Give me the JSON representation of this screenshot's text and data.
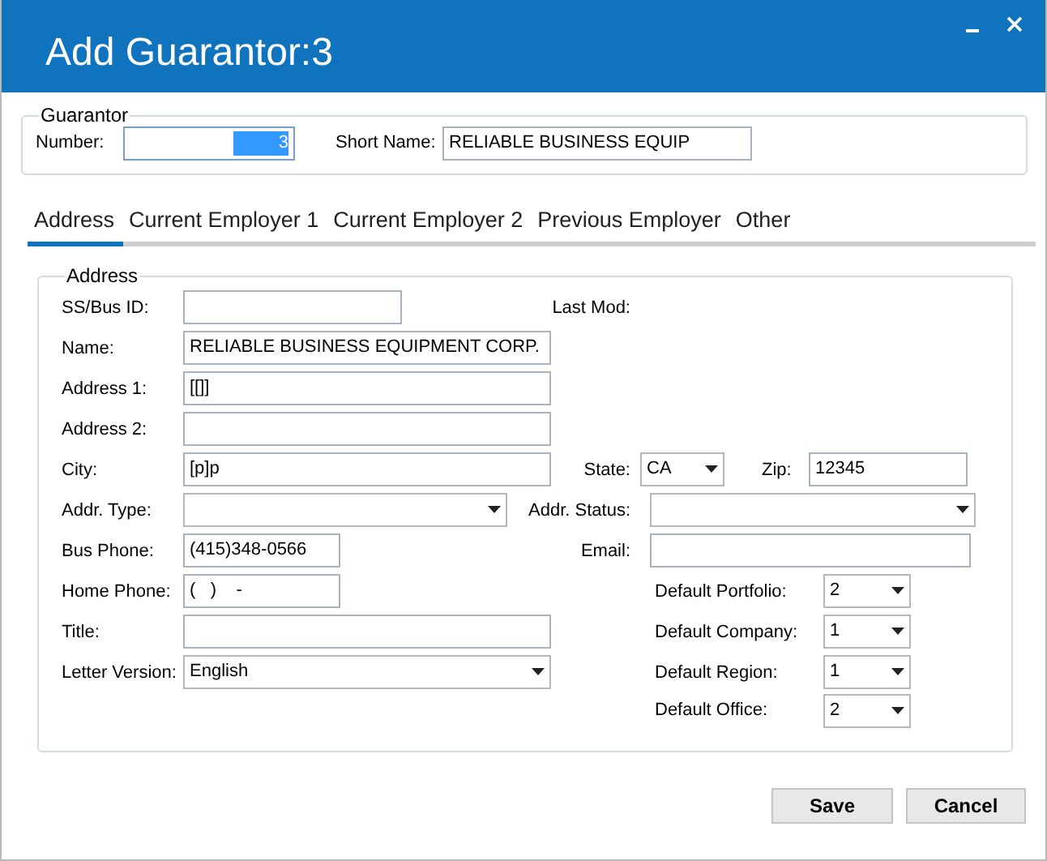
{
  "window": {
    "title": "Add Guarantor:3"
  },
  "guarantor": {
    "legend": "Guarantor",
    "number": {
      "label": "Number:",
      "value": "3",
      "text_selected": true
    },
    "short_name": {
      "label": "Short Name:",
      "value": "RELIABLE BUSINESS EQUIP"
    }
  },
  "tabs": [
    {
      "label": "Address",
      "selected": true
    },
    {
      "label": "Current Employer 1",
      "selected": false
    },
    {
      "label": "Current Employer 2",
      "selected": false
    },
    {
      "label": "Previous Employer",
      "selected": false
    },
    {
      "label": "Other",
      "selected": false
    }
  ],
  "address": {
    "legend": "Address",
    "ss_bus_id": {
      "label": "SS/Bus ID:"
    },
    "last_mod": {
      "label": "Last Mod:"
    },
    "name": {
      "label": "Name:",
      "value": "RELIABLE BUSINESS EQUIPMENT CORP."
    },
    "address_1": {
      "label": "Address 1:",
      "value": "[[]]"
    },
    "address_2": {
      "label": "Address 2:"
    },
    "city": {
      "label": "City:",
      "value": "[p]p"
    },
    "state": {
      "label": "State:",
      "value": "CA"
    },
    "zip": {
      "label": "Zip:",
      "value": "12345"
    },
    "addr_type": {
      "label": "Addr. Type:"
    },
    "addr_status": {
      "label": "Addr. Status:"
    },
    "bus_phone": {
      "label": "Bus Phone:",
      "value": "(415)348-0566"
    },
    "email": {
      "label": "Email:"
    },
    "home_phone": {
      "label": "Home Phone:",
      "value": "(   )    -"
    },
    "default_portfolio": {
      "label": "Default Portfolio:",
      "value": "2"
    },
    "title": {
      "label": "Title:"
    },
    "default_company": {
      "label": "Default Company:",
      "value": "1"
    },
    "letter_version": {
      "label": "Letter Version:",
      "value": "English"
    },
    "default_region": {
      "label": "Default Region:",
      "value": "1"
    },
    "default_office": {
      "label": "Default Office:",
      "value": "2"
    }
  },
  "buttons": [
    "Save",
    "Cancel"
  ]
}
